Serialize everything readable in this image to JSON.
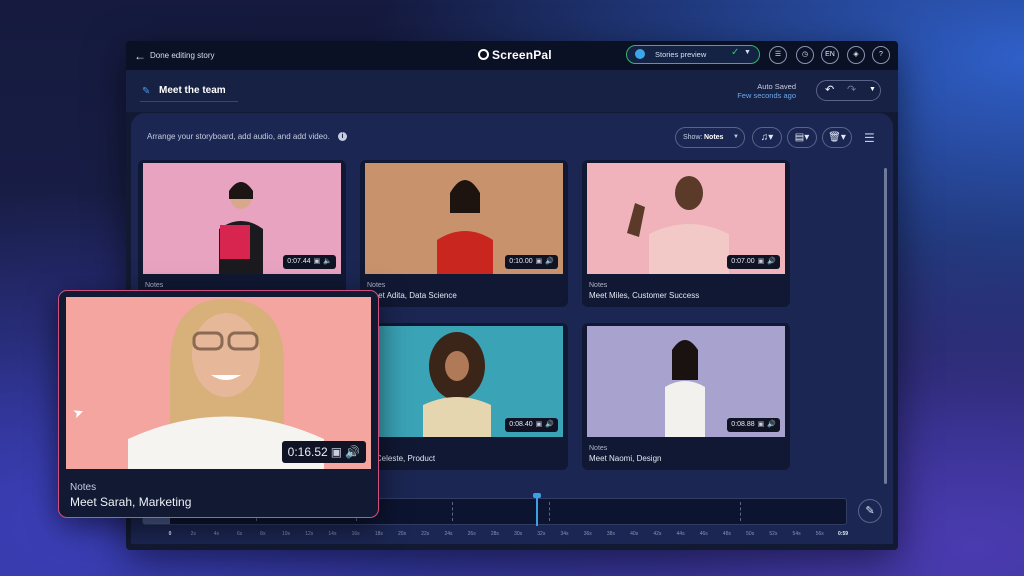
{
  "topbar": {
    "back_label": "Done editing story",
    "logo": "ScreenPal",
    "preview_label": "Stories preview",
    "lang": "EN",
    "help": "?"
  },
  "header": {
    "story_title": "Meet the team",
    "save_status": "Auto Saved",
    "save_time": "Few seconds ago"
  },
  "toolbar": {
    "hint": "Arrange your storyboard, add audio, and add video.",
    "show_label": "Show:",
    "show_value": "Notes"
  },
  "cards": [
    {
      "duration": "0:07.44",
      "notes": "Notes",
      "title": "",
      "bg": "#e8a3c0"
    },
    {
      "duration": "0:10.00",
      "notes": "Notes",
      "title": "Meet Adita, Data Science",
      "bg": "#c8926c"
    },
    {
      "duration": "0:07.00",
      "notes": "Notes",
      "title": "Meet Miles, Customer Success",
      "bg": "#f0b3bb"
    },
    {
      "duration": "0:08.40",
      "notes": "",
      "title": "et Celeste, Product",
      "bg": "#3aa3b6"
    },
    {
      "duration": "0:08.88",
      "notes": "Notes",
      "title": "Meet Naomi, Design",
      "bg": "#a8a2cf"
    }
  ],
  "featured": {
    "duration": "0:16.52",
    "notes": "Notes",
    "title": "Meet Sarah, Marketing",
    "bg": "#f4a5a0"
  },
  "timeline": {
    "ticks": [
      "0",
      "2s",
      "4s",
      "6s",
      "8s",
      "10s",
      "12s",
      "14s",
      "16s",
      "18s",
      "20s",
      "22s",
      "24s",
      "26s",
      "28s",
      "30s",
      "32s",
      "34s",
      "36s",
      "38s",
      "40s",
      "42s",
      "44s",
      "46s",
      "48s",
      "50s",
      "52s",
      "54s",
      "56s",
      "0:59"
    ]
  }
}
